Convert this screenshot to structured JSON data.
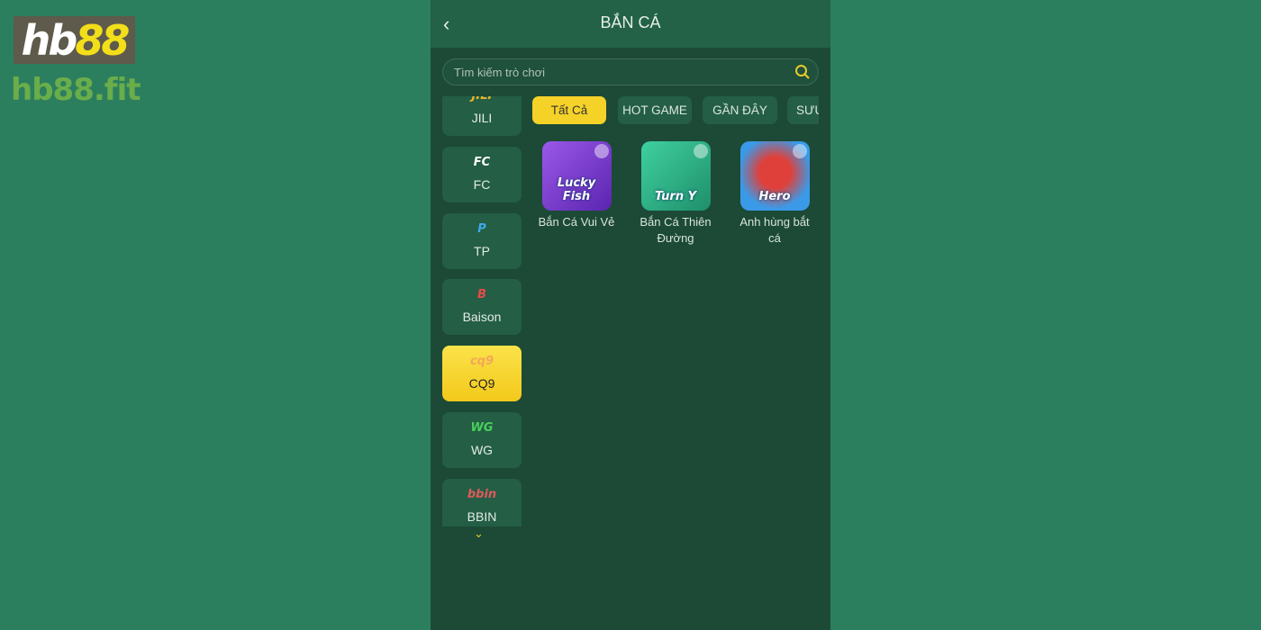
{
  "watermark": {
    "logo_white": "hb",
    "logo_yellow": "88",
    "site": "hb88.fit"
  },
  "header": {
    "title": "BẮN CÁ",
    "back_icon": "chevron-left-icon"
  },
  "search": {
    "placeholder": "Tìm kiếm trò chơi",
    "icon": "search-icon"
  },
  "providers": [
    {
      "label": "JILI",
      "icon": "jili-logo"
    },
    {
      "label": "FC",
      "icon": "fc-logo"
    },
    {
      "label": "TP",
      "icon": "tp-logo"
    },
    {
      "label": "Baison",
      "icon": "baison-logo"
    },
    {
      "label": "CQ9",
      "icon": "cq9-logo",
      "active": true
    },
    {
      "label": "WG",
      "icon": "wg-logo"
    },
    {
      "label": "BBIN",
      "icon": "bbin-logo"
    }
  ],
  "tabs": [
    {
      "label": "Tất Cả",
      "active": true
    },
    {
      "label": "HOT GAME"
    },
    {
      "label": "GẦN ĐÂY"
    },
    {
      "label": "SƯU"
    }
  ],
  "games": [
    {
      "name": "Bắn Cá Vui Vẻ",
      "art_text": "Lucky Fish",
      "color": "#7a3fd0"
    },
    {
      "name": "Bắn Cá Thiên Đường",
      "art_text": "Turn Y",
      "color": "#2fb78c"
    },
    {
      "name": "Anh hùng bắt cá",
      "art_text": "Hero",
      "color": "#2f8fe0"
    }
  ],
  "colors": {
    "accent": "#f5d228",
    "panel": "#1c4a37",
    "background": "#2b7f5f"
  }
}
